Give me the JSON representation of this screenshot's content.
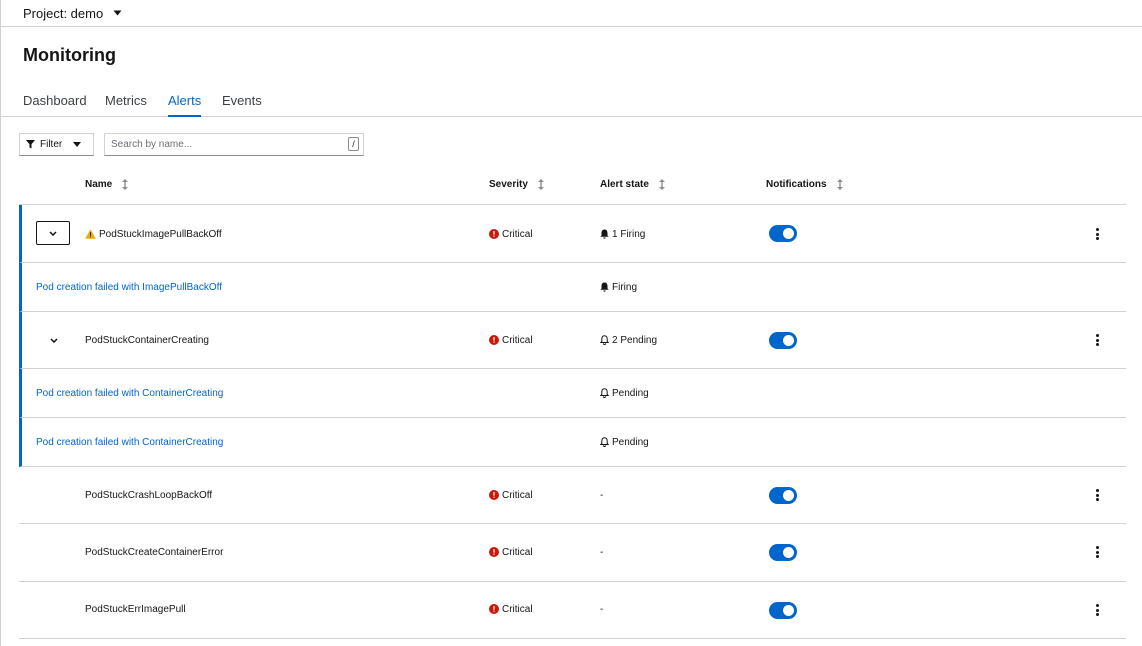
{
  "project": {
    "label": "Project: demo"
  },
  "page": {
    "title": "Monitoring"
  },
  "tabs": [
    {
      "label": "Dashboard",
      "active": false
    },
    {
      "label": "Metrics",
      "active": false
    },
    {
      "label": "Alerts",
      "active": true
    },
    {
      "label": "Events",
      "active": false
    }
  ],
  "toolbar": {
    "filter_label": "Filter",
    "search_placeholder": "Search by name...",
    "search_value": "",
    "shortcut_key": "/"
  },
  "table": {
    "columns": [
      "Name",
      "Severity",
      "Alert state",
      "Notifications"
    ],
    "rules": [
      {
        "name": "PodStuckImagePullBackOff",
        "severity": "Critical",
        "state": "1 Firing",
        "notifications": true,
        "expanded": true
      },
      {
        "name": "PodStuckContainerCreating",
        "severity": "Critical",
        "state": "2 Pending",
        "notifications": true,
        "expanded": true
      },
      {
        "name": "PodStuckCrashLoopBackOff",
        "severity": "Critical",
        "state": "-",
        "notifications": true,
        "expanded": false
      },
      {
        "name": "PodStuckCreateContainerError",
        "severity": "Critical",
        "state": "-",
        "notifications": true,
        "expanded": false
      },
      {
        "name": "PodStuckErrImagePull",
        "severity": "Critical",
        "state": "-",
        "notifications": true,
        "expanded": false
      }
    ],
    "alerts": [
      {
        "message": "Pod creation failed with ImagePullBackOff",
        "state": "Firing"
      },
      {
        "message": "Pod creation failed with ContainerCreating",
        "state": "Pending"
      },
      {
        "message": "Pod creation failed with ContainerCreating",
        "state": "Pending"
      }
    ]
  },
  "colors": {
    "accent": "#0066cc",
    "critical": "#c9190b",
    "warning": "#f0ab00",
    "border": "#d2d2d2"
  },
  "icons": {
    "project_caret": "caret-down-icon",
    "filter": "filter-icon",
    "sort": "sort-icon",
    "expand": "chevron-down-icon",
    "warning": "warning-triangle-icon",
    "critical": "exclamation-circle-icon",
    "firing": "bell-filled-icon",
    "pending": "bell-outline-icon",
    "actions": "kebab-icon"
  }
}
